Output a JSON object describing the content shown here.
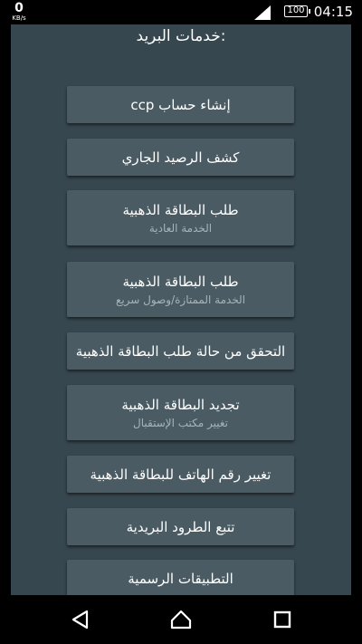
{
  "status": {
    "net_speed": "0",
    "net_unit": "KB/s",
    "battery": "100",
    "time": "04:15"
  },
  "page": {
    "title": "خدمات البريد:"
  },
  "buttons": [
    {
      "label": "إنشاء حساب ccp"
    },
    {
      "label": "كشف الرصيد الجاري"
    },
    {
      "label": "طلب البطاقة الذهبية",
      "sub": "الخدمة العادية"
    },
    {
      "label": "طلب البطاقة الذهبية",
      "sub": "الخدمة الممتازة/وصول سريع"
    },
    {
      "label": "التحقق من حالة طلب البطاقة الذهبية"
    },
    {
      "label": "تجديد البطاقة الذهبية",
      "sub": "تغيير مكتب الإستقبال"
    },
    {
      "label": "تغيير رقم الهاتف للبطاقة الذهبية"
    },
    {
      "label": "تتبع الطرود البريدية"
    },
    {
      "label": "التطبيقات الرسمية"
    }
  ],
  "icons": {
    "signal": "signal-icon",
    "battery": "battery-icon",
    "back": "back-triangle-icon",
    "home": "home-icon",
    "recents": "recents-square-icon"
  },
  "colors": {
    "panel": "#37474f",
    "button": "#4a5b63",
    "subtext": "#a6b4ba"
  }
}
